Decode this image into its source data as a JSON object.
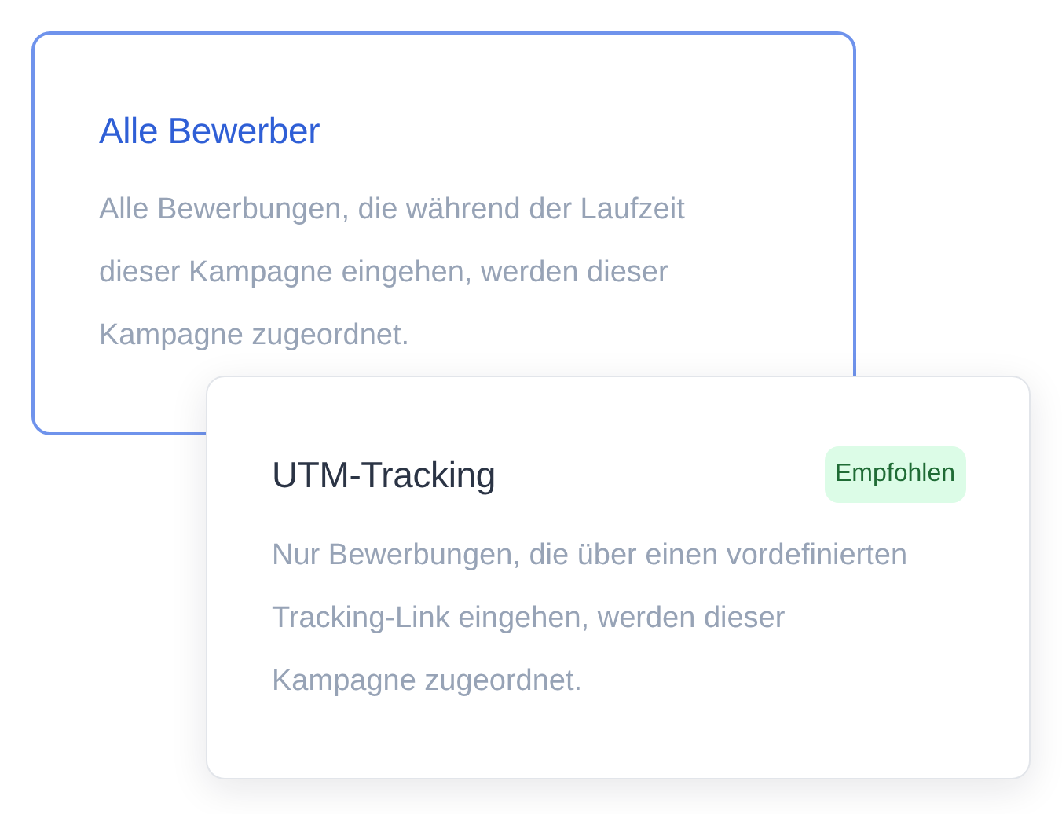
{
  "options": [
    {
      "title": "Alle Bewerber",
      "description": "Alle Bewerbungen, die während der Laufzeit dieser Kampagne eingehen, werden dieser Kampagne zugeordnet.",
      "selected": true
    },
    {
      "title": "UTM-Tracking",
      "badge": "Empfohlen",
      "description": "Nur Bewerbungen, die über einen vordefinierten Tracking-Link eingehen, werden dieser Kampagne zugeordnet.",
      "selected": false
    }
  ]
}
